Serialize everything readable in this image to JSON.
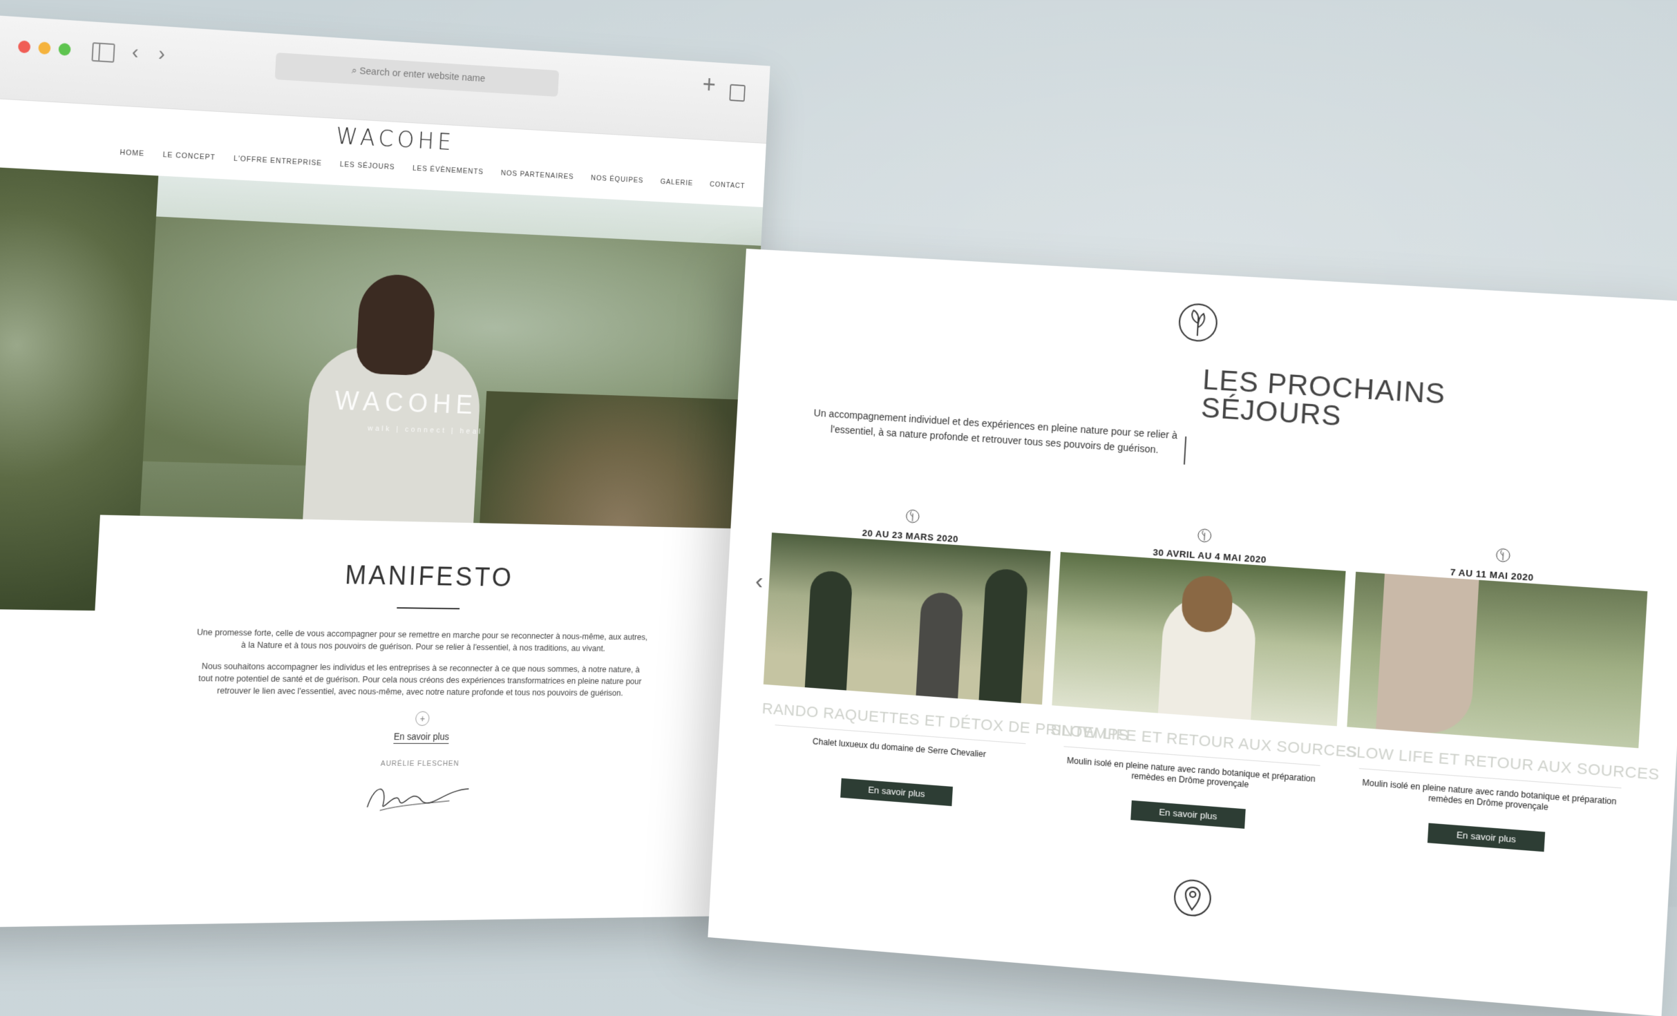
{
  "browser": {
    "address_placeholder": "Search or enter website name"
  },
  "site": {
    "logo": "WACOHE",
    "nav": [
      "HOME",
      "LE CONCEPT",
      "L'OFFRE ENTREPRISE",
      "LES SÉJOURS",
      "LES ÉVÈNEMENTS",
      "NOS PARTENAIRES",
      "NOS ÉQUIPES",
      "GALERIE",
      "CONTACT"
    ],
    "hero_logo": "WACOHE",
    "hero_tagline": "walk | connect | heal"
  },
  "manifesto": {
    "title": "MANIFESTO",
    "paragraph1": "Une promesse forte, celle de vous accompagner pour se remettre en marche pour se reconnecter à nous-même, aux autres, à la Nature et à tous nos pouvoirs de guérison. Pour se relier à l'essentiel, à nos traditions, au vivant.",
    "paragraph2": "Nous souhaitons accompagner les individus et les entreprises à se reconnecter à ce que nous sommes, à notre nature, à tout notre potentiel de santé et de guérison. Pour cela nous créons des expériences transformatrices en pleine nature pour retrouver le lien avec l'essentiel, avec nous-même, avec notre nature profonde et tous nos pouvoirs de guérison.",
    "plus": "+",
    "link": "En savoir plus",
    "author": "AURÉLIE FLESCHEN"
  },
  "sejours": {
    "title_line1": "LES PROCHAINS",
    "title_line2": "SÉJOURS",
    "description": "Un accompagnement individuel et des expériences en pleine nature pour se relier à l'essentiel, à sa nature profonde et retrouver tous ses pouvoirs de guérison.",
    "prev_arrow": "‹",
    "next_arrow": "›",
    "cards": [
      {
        "date": "20 AU 23 MARS 2020",
        "title": "RANDO RAQUETTES ET DÉTOX DE PRINTEMPS",
        "subtitle": "Chalet luxueux du domaine de Serre Chevalier",
        "button": "En savoir plus"
      },
      {
        "date": "30 AVRIL AU 4 MAI 2020",
        "title": "SLOW LIFE ET RETOUR AUX SOURCES",
        "subtitle": "Moulin isolé en pleine nature avec rando botanique et préparation remèdes en Drôme provençale",
        "button": "En savoir plus"
      },
      {
        "date": "7 AU 11 MAI 2020",
        "title": "SLOW LIFE ET RETOUR AUX SOURCES",
        "subtitle": "Moulin isolé en pleine nature avec rando botanique et préparation remèdes en Drôme provençale",
        "button": "En savoir plus"
      }
    ]
  },
  "colors": {
    "button_bg": "#2d3d34",
    "background": "#cdd7da"
  }
}
